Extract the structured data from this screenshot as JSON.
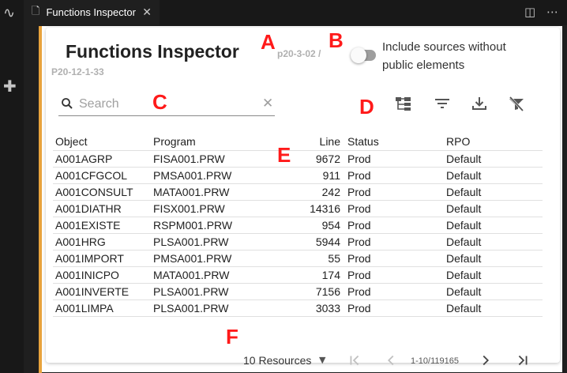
{
  "tab": {
    "title": "Functions Inspector"
  },
  "panel": {
    "title": "Functions Inspector",
    "subtitle_line1": "p20-3-02 /",
    "subtitle_line2": "P20-12-1-33",
    "toggle_label": "Include sources without public elements",
    "toggle_on": false
  },
  "search": {
    "placeholder": "Search",
    "value": ""
  },
  "toolbar": {
    "icons": [
      "hierarchy-icon",
      "filter-icon",
      "download-icon",
      "clear-filter-icon"
    ]
  },
  "table": {
    "columns": [
      "Object",
      "Program",
      "Line",
      "Status",
      "RPO"
    ],
    "rows": [
      [
        "A001AGRP",
        "FISA001.PRW",
        "9672",
        "Prod",
        "Default"
      ],
      [
        "A001CFGCOL",
        "PMSA001.PRW",
        "911",
        "Prod",
        "Default"
      ],
      [
        "A001CONSULT",
        "MATA001.PRW",
        "242",
        "Prod",
        "Default"
      ],
      [
        "A001DIATHR",
        "FISX001.PRW",
        "14316",
        "Prod",
        "Default"
      ],
      [
        "A001EXISTE",
        "RSPM001.PRW",
        "954",
        "Prod",
        "Default"
      ],
      [
        "A001HRG",
        "PLSA001.PRW",
        "5944",
        "Prod",
        "Default"
      ],
      [
        "A001IMPORT",
        "PMSA001.PRW",
        "55",
        "Prod",
        "Default"
      ],
      [
        "A001INICPO",
        "MATA001.PRW",
        "174",
        "Prod",
        "Default"
      ],
      [
        "A001INVERTE",
        "PLSA001.PRW",
        "7156",
        "Prod",
        "Default"
      ],
      [
        "A001LIMPA",
        "PLSA001.PRW",
        "3033",
        "Prod",
        "Default"
      ]
    ]
  },
  "pagination": {
    "per_page_label": "10 Resources",
    "range": "1-10/119165"
  },
  "annotations": [
    "A",
    "B",
    "C",
    "D",
    "E",
    "F"
  ],
  "colors": {
    "accent_bar": "#e8a33d",
    "annotation": "#ff1a1a"
  }
}
